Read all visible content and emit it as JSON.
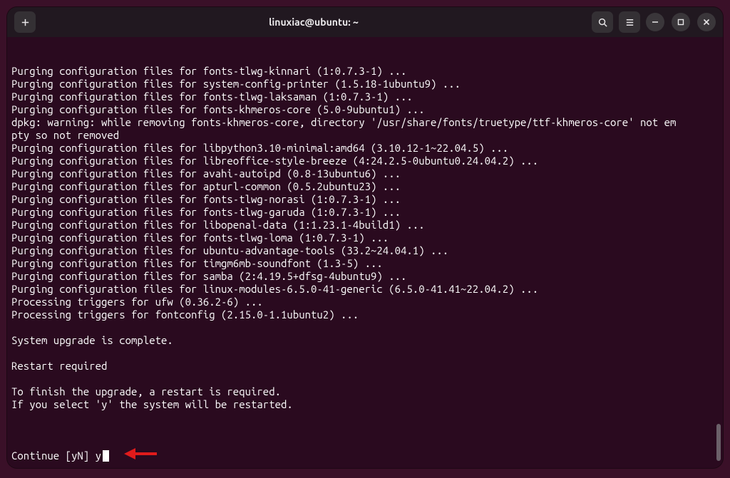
{
  "window": {
    "title": "linuxiac@ubuntu: ~"
  },
  "terminal": {
    "lines": [
      "Purging configuration files for fonts-tlwg-kinnari (1:0.7.3-1) ...",
      "Purging configuration files for system-config-printer (1.5.18-1ubuntu9) ...",
      "Purging configuration files for fonts-tlwg-laksaman (1:0.7.3-1) ...",
      "Purging configuration files for fonts-khmeros-core (5.0-9ubuntu1) ...",
      "dpkg: warning: while removing fonts-khmeros-core, directory '/usr/share/fonts/truetype/ttf-khmeros-core' not empty so not removed",
      "Purging configuration files for libpython3.10-minimal:amd64 (3.10.12-1~22.04.5) ...",
      "Purging configuration files for libreoffice-style-breeze (4:24.2.5-0ubuntu0.24.04.2) ...",
      "Purging configuration files for avahi-autoipd (0.8-13ubuntu6) ...",
      "Purging configuration files for apturl-common (0.5.2ubuntu23) ...",
      "Purging configuration files for fonts-tlwg-norasi (1:0.7.3-1) ...",
      "Purging configuration files for fonts-tlwg-garuda (1:0.7.3-1) ...",
      "Purging configuration files for libopenal-data (1:1.23.1-4build1) ...",
      "Purging configuration files for fonts-tlwg-loma (1:0.7.3-1) ...",
      "Purging configuration files for ubuntu-advantage-tools (33.2~24.04.1) ...",
      "Purging configuration files for timgm6mb-soundfont (1.3-5) ...",
      "Purging configuration files for samba (2:4.19.5+dfsg-4ubuntu9) ...",
      "Purging configuration files for linux-modules-6.5.0-41-generic (6.5.0-41.41~22.04.2) ...",
      "Processing triggers for ufw (0.36.2-6) ...",
      "Processing triggers for fontconfig (2.15.0-1.1ubuntu2) ...",
      "",
      "System upgrade is complete.",
      "",
      "Restart required",
      "",
      "To finish the upgrade, a restart is required.",
      "If you select 'y' the system will be restarted.",
      ""
    ],
    "prompt": "Continue [yN] ",
    "input": "y"
  }
}
